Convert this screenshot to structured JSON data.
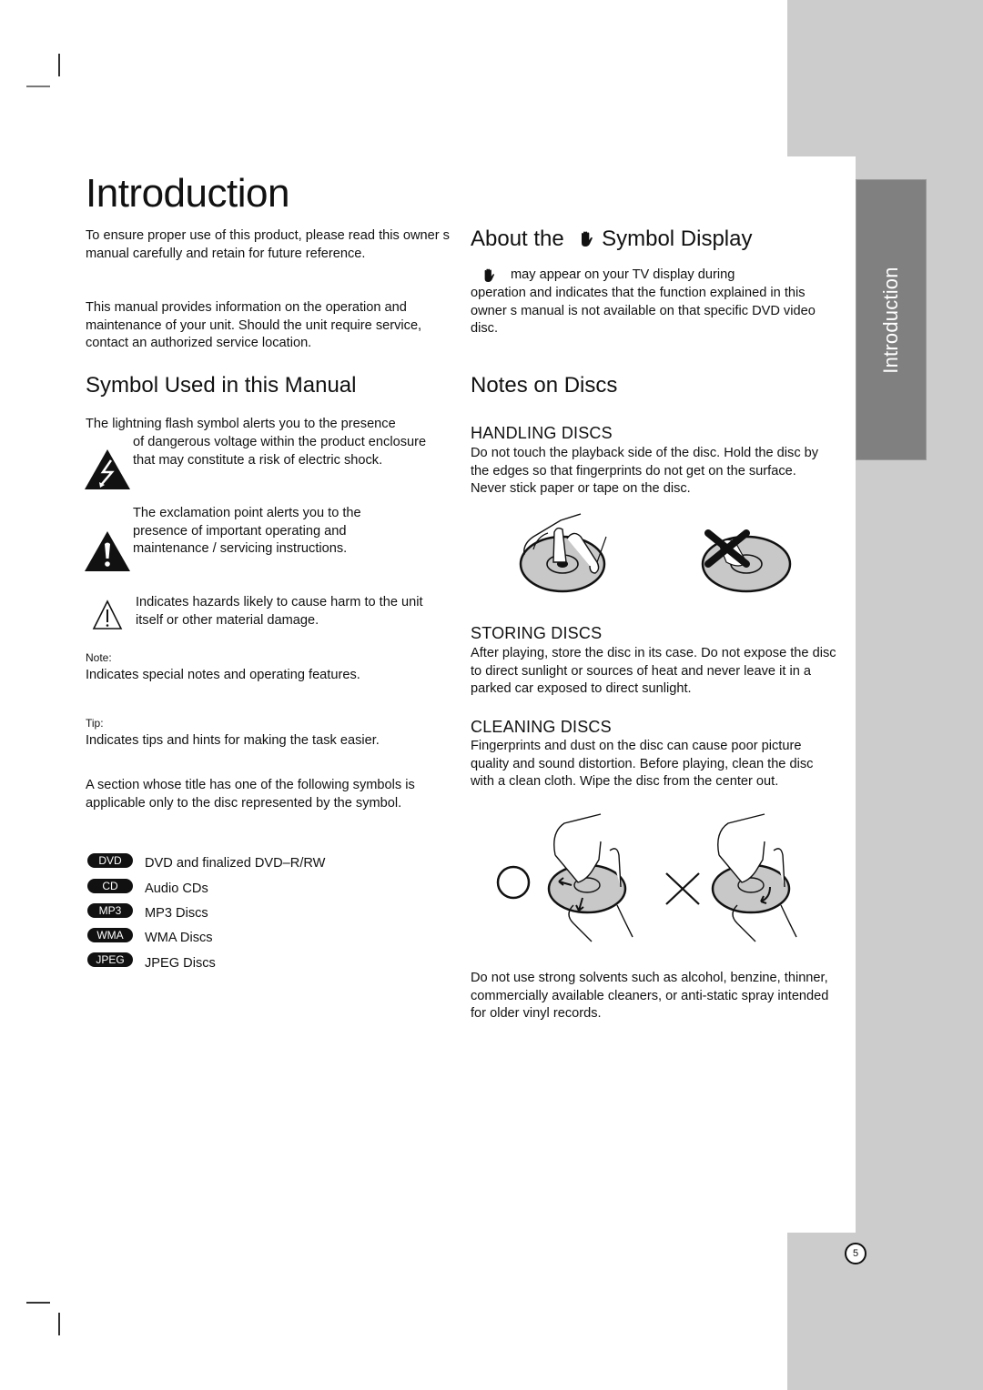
{
  "page": {
    "title": "Introduction",
    "side_tab": "Introduction",
    "page_number": "5"
  },
  "intro": {
    "para1": "To ensure proper use of this product, please read this owner s manual carefully and retain for future reference.",
    "para2": "This manual provides information on the operation and maintenance of your unit. Should the unit require service, contact an authorized service location."
  },
  "symbols_section": {
    "heading": "Symbol Used in this Manual",
    "lightning": {
      "icon": "lightning-warning-icon",
      "line1": "The lightning flash symbol alerts you to the presence",
      "rest": "of dangerous voltage within the product enclosure that may constitute a risk of electric shock."
    },
    "exclamation": {
      "icon": "exclamation-warning-icon",
      "text": "The exclamation point alerts you to the presence of important operating and maintenance / servicing instructions."
    },
    "caution": {
      "icon": "caution-outline-icon",
      "text": "Indicates hazards likely to cause harm to the unit itself or other material damage."
    },
    "note": {
      "label": "Note:",
      "text": "Indicates special notes and operating features."
    },
    "tip": {
      "label": "Tip:",
      "text": "Indicates tips and hints for making the task easier."
    },
    "disc_intro": "A section whose title has one of the following symbols is applicable only to the disc represented by the symbol.",
    "disc_types": [
      {
        "badge": "DVD",
        "label": "DVD and finalized DVD–R/RW"
      },
      {
        "badge": "CD",
        "label": "Audio CDs"
      },
      {
        "badge": "MP3",
        "label": "MP3 Discs"
      },
      {
        "badge": "WMA",
        "label": "WMA Discs"
      },
      {
        "badge": "JPEG",
        "label": "JPEG Discs"
      }
    ]
  },
  "about_symbol": {
    "heading_before": "About the",
    "heading_after": "Symbol Display",
    "icon": "hand-prohibited-icon",
    "line1": "may appear on your TV display during",
    "rest": "operation and indicates that the function explained in this owner s manual is not available on that specific DVD video disc."
  },
  "notes_on_discs": {
    "heading": "Notes on Discs",
    "handling": {
      "heading": "HANDLING DISCS",
      "text": "Do not touch the playback side of the disc. Hold the disc by the edges so that fingerprints do not get on the surface. Never stick paper or tape on the disc."
    },
    "storing": {
      "heading": "STORING DISCS",
      "text": "After playing, store the disc in its case. Do not expose the disc to direct sunlight or sources of heat and never leave it in a parked car exposed to direct sunlight."
    },
    "cleaning": {
      "heading": "CLEANING DISCS",
      "text": "Fingerprints and dust on the disc can cause poor picture quality and sound distortion. Before playing, clean the disc with a clean cloth. Wipe the disc from the center out."
    },
    "solvents": "Do not use strong solvents such as alcohol, benzine, thinner, commercially available cleaners, or anti-static spray intended for older vinyl records."
  },
  "colors": {
    "band": "#cccccc",
    "tab": "#808080",
    "disc_fill": "#c8c8c8",
    "text": "#111111"
  }
}
